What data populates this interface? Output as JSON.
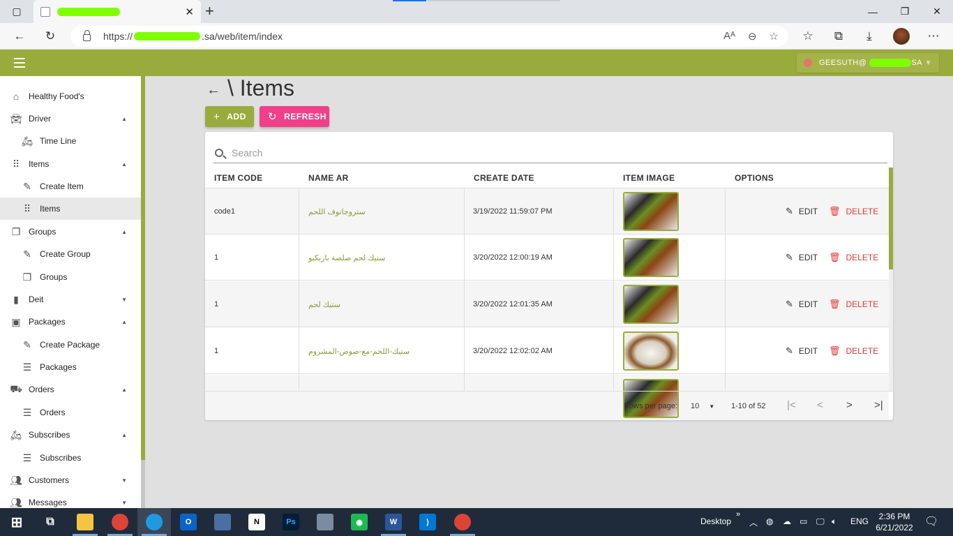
{
  "browser": {
    "url_prefix": "https://",
    "url_suffix": ".sa/web/item/index",
    "icons": [
      "tab-actions-icon",
      "close-icon",
      "new-tab-icon",
      "minimize-icon",
      "maximize-icon",
      "close-window-icon",
      "back-icon",
      "reload-icon",
      "lock-icon",
      "read-aloud-icon",
      "zoom-icon",
      "add-favorite-icon",
      "favorites-icon",
      "collections-icon",
      "downloads-icon",
      "profile-avatar",
      "more-icon"
    ]
  },
  "appbar": {
    "user_prefix": "GEESUTH@",
    "user_suffix": "SA",
    "accent": "#9aab3d"
  },
  "sidebar": {
    "items": [
      {
        "label": "Healthy Food's",
        "icon": "home-icon"
      },
      {
        "label": "Driver",
        "icon": "car-icon"
      },
      {
        "label": "Time Line",
        "icon": "moped-icon"
      },
      {
        "label": "Items",
        "icon": "grid-icon"
      },
      {
        "label": "Create Item",
        "icon": "pencil-icon"
      },
      {
        "label": "Items",
        "icon": "grid-icon"
      },
      {
        "label": "Groups",
        "icon": "stack-icon"
      },
      {
        "label": "Create Group",
        "icon": "pencil-icon"
      },
      {
        "label": "Groups",
        "icon": "stack-icon"
      },
      {
        "label": "Deit",
        "icon": "bar-chart-icon"
      },
      {
        "label": "Packages",
        "icon": "bag-icon"
      },
      {
        "label": "Create Package",
        "icon": "pencil-icon"
      },
      {
        "label": "Packages",
        "icon": "list-icon"
      },
      {
        "label": "Orders",
        "icon": "delivery-icon"
      },
      {
        "label": "Orders",
        "icon": "list-icon"
      },
      {
        "label": "Subscribes",
        "icon": "moped-clock-icon"
      },
      {
        "label": "Subscribes",
        "icon": "list-icon"
      },
      {
        "label": "Customers",
        "icon": "people-icon"
      },
      {
        "label": "Messages",
        "icon": "people-icon"
      }
    ]
  },
  "main": {
    "title": "\\ Items",
    "add_label": "ADD",
    "refresh_label": "REFRESH",
    "search_placeholder": "Search",
    "columns": [
      "ITEM CODE",
      "NAME AR",
      "CREATE DATE",
      "ITEM IMAGE",
      "OPTIONS"
    ],
    "rows": [
      {
        "code": "code1",
        "name_ar": "ستروجانوف اللحم",
        "date": "3/19/2022 11:59:07 PM"
      },
      {
        "code": "1",
        "name_ar": "ستيك لحم صلصة باربكيو",
        "date": "3/20/2022 12:00:19 AM"
      },
      {
        "code": "1",
        "name_ar": "ستيك لحم",
        "date": "3/20/2022 12:01:35 AM"
      },
      {
        "code": "1",
        "name_ar": "ستيك-اللحم-مع-صوص-المشروم",
        "date": "3/20/2022 12:02:02 AM"
      }
    ],
    "edit_label": "EDIT",
    "delete_label": "DELETE",
    "rows_per_page_label": "Rows per page:",
    "rows_per_page": "10",
    "range": "1-10 of 52"
  },
  "taskbar": {
    "desktop_label": "Desktop",
    "lang": "ENG",
    "time": "2:36 PM",
    "date": "6/21/2022"
  }
}
